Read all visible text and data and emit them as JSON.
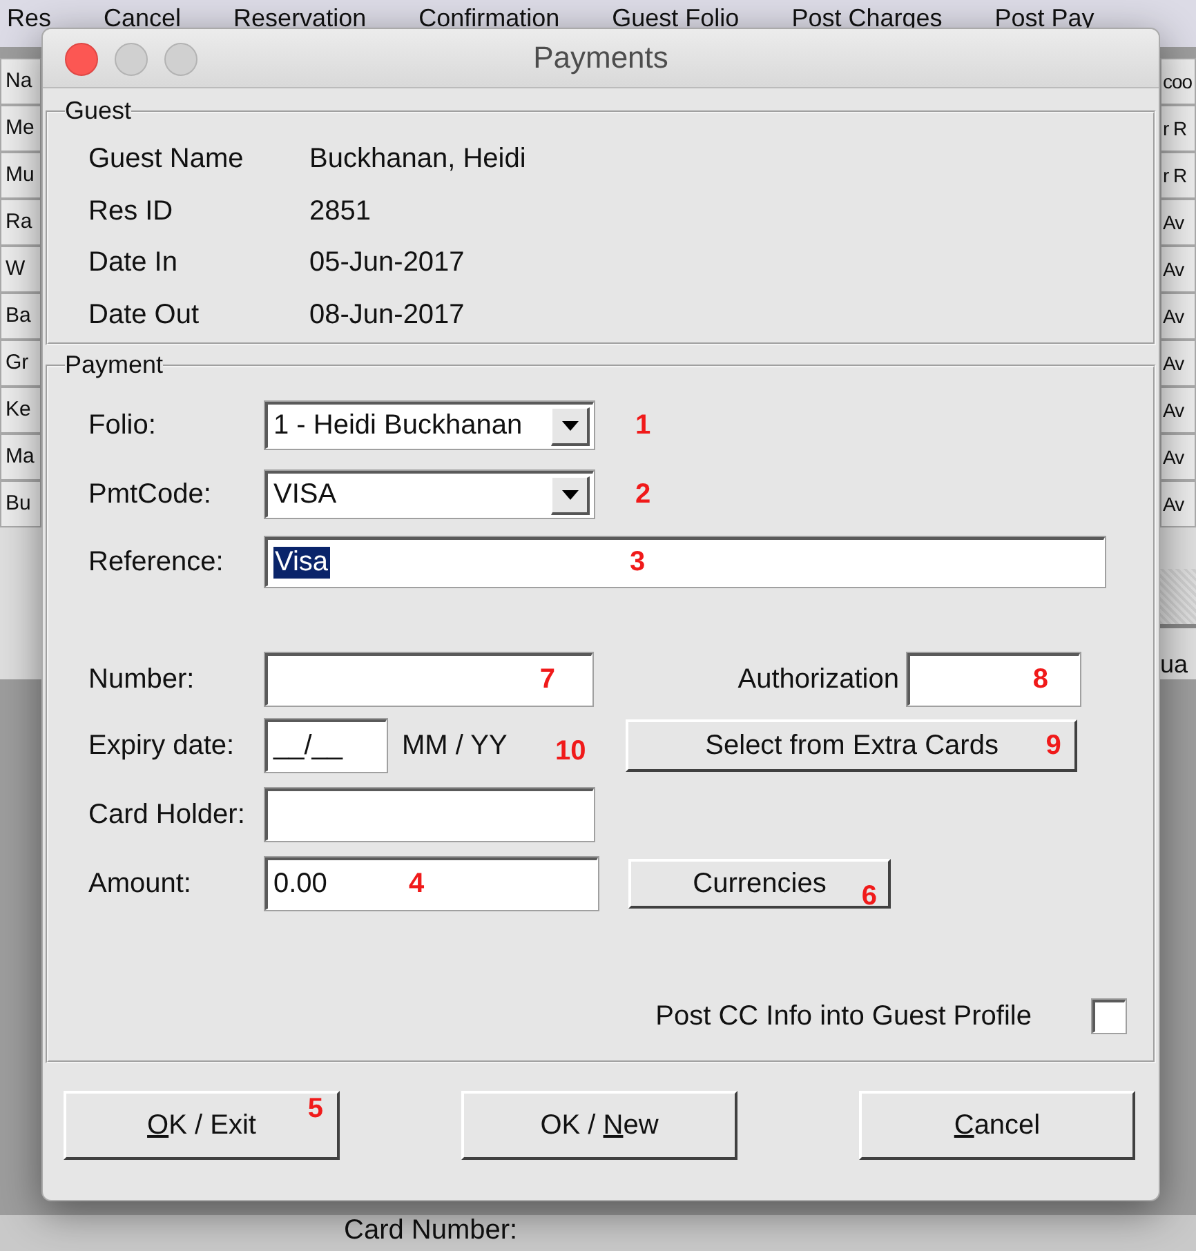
{
  "background_app": {
    "menu": [
      "Res",
      "Cancel",
      "Reservation",
      "Confirmation",
      "Guest Folio",
      "Post Charges",
      "Post Pay"
    ],
    "left_column": [
      "Na",
      "Me",
      "Mu",
      "Ra",
      "W",
      "Ba",
      "Gr",
      "Ke",
      "Ma",
      "Bu"
    ],
    "right_column": [
      "coo",
      "r R",
      "r R",
      "Av",
      "Av",
      "Av",
      "Av",
      "Av",
      "Av",
      "Av"
    ],
    "right_label": "ua",
    "bottom_label": "Card Number:"
  },
  "window": {
    "title": "Payments"
  },
  "guest": {
    "title": "Guest",
    "rows": [
      {
        "label": "Guest Name",
        "value": "Buckhanan, Heidi"
      },
      {
        "label": "Res ID",
        "value": "2851"
      },
      {
        "label": "Date In",
        "value": "05-Jun-2017"
      },
      {
        "label": "Date Out",
        "value": "08-Jun-2017"
      }
    ]
  },
  "payment": {
    "title": "Payment",
    "folio": {
      "label": "Folio:",
      "value": "1 - Heidi Buckhanan",
      "annotation": "1"
    },
    "pmt_code": {
      "label": "PmtCode:",
      "value": "VISA",
      "annotation": "2"
    },
    "reference": {
      "label": "Reference:",
      "value": "Visa",
      "selected": true,
      "annotation": "3"
    },
    "number": {
      "label": "Number:",
      "annotation": "7"
    },
    "authorization": {
      "label": "Authorization",
      "annotation": "8"
    },
    "expiry": {
      "label": "Expiry date:",
      "value": "__/__",
      "format": "MM / YY",
      "annotation": "10"
    },
    "extra_cards_button": {
      "label": "Select from Extra Cards",
      "annotation": "9"
    },
    "card_holder": {
      "label": "Card Holder:"
    },
    "amount": {
      "label": "Amount:",
      "value": "0.00",
      "annotation": "4"
    },
    "currencies_button": {
      "label": "Currencies",
      "annotation": "6"
    },
    "post_cc": {
      "label": "Post CC Info into Guest Profile",
      "checked": false
    }
  },
  "buttons": [
    {
      "key": "O",
      "after": "K / Exit",
      "annotation": "5"
    },
    {
      "before": "OK / ",
      "key": "N",
      "after": "ew"
    },
    {
      "key": "C",
      "after": "ancel"
    }
  ]
}
